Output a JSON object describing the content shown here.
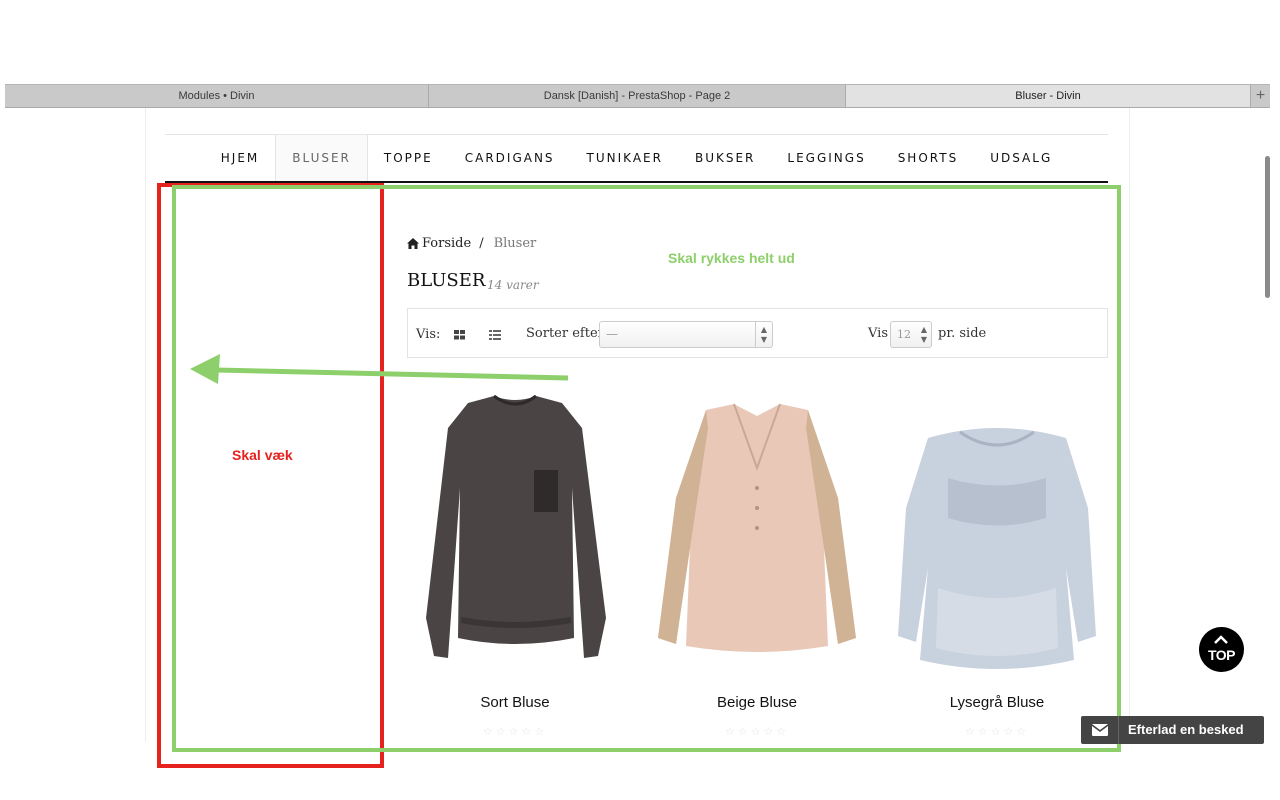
{
  "browser": {
    "tabs": [
      {
        "label": "Modules • Divin"
      },
      {
        "label": "Dansk [Danish] - PrestaShop - Page 2"
      },
      {
        "label": "Bluser - Divin"
      }
    ],
    "new_tab": "+"
  },
  "nav": {
    "items": [
      "HJEM",
      "BLUSER",
      "TOPPE",
      "CARDIGANS",
      "TUNIKAER",
      "BUKSER",
      "LEGGINGS",
      "SHORTS",
      "UDSALG"
    ],
    "active": "BLUSER"
  },
  "breadcrumb": {
    "home": "Forside",
    "separator": "/",
    "current": "Bluser"
  },
  "category": {
    "title": "BLUSER",
    "count": "14 varer"
  },
  "toolbar": {
    "view_label": "Vis:",
    "sort_label": "Sorter efter",
    "sort_value": "—",
    "per_page_label": "Vis",
    "per_page_value": "12",
    "per_page_suffix": "pr. side"
  },
  "products": [
    {
      "name": "Sort Bluse",
      "rating": 0,
      "max_rating": 5,
      "color": "#4a4544"
    },
    {
      "name": "Beige Bluse",
      "rating": 0,
      "max_rating": 5,
      "color": "#e9c8b8"
    },
    {
      "name": "Lysegrå Bluse",
      "rating": 0,
      "max_rating": 5,
      "color": "#c8d1de"
    }
  ],
  "annotations": {
    "red_label": "Skal væk",
    "green_label": "Skal rykkes helt ud",
    "red_color": "#e5221e",
    "green_color": "#8dcf6a"
  },
  "top_button": {
    "label": "TOP"
  },
  "chat": {
    "label": "Efterlad en besked"
  }
}
